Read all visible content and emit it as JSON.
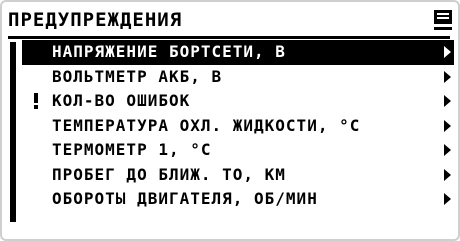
{
  "screen": {
    "title": "ПРЕДУПРЕЖДЕНИЯ",
    "menu_icon": "list-menu-icon"
  },
  "items": [
    {
      "label": "НАПРЯЖЕНИЕ БОРТСЕТИ, В",
      "selected": true,
      "warning": false
    },
    {
      "label": "ВОЛЬТМЕТР АКБ, В",
      "selected": false,
      "warning": false
    },
    {
      "label": "КОЛ-ВО ОШИБОК",
      "selected": false,
      "warning": true
    },
    {
      "label": "ТЕМПЕРАТУРА ОХЛ. ЖИДКОСТИ, °С",
      "selected": false,
      "warning": false
    },
    {
      "label": "ТЕРМОМЕТР 1, °С",
      "selected": false,
      "warning": false
    },
    {
      "label": "ПРОБЕГ ДО БЛИЖ. ТО, КМ",
      "selected": false,
      "warning": false
    },
    {
      "label": "ОБОРОТЫ ДВИГАТЕЛЯ, ОБ/МИН",
      "selected": false,
      "warning": false
    }
  ],
  "icons": {
    "submenu": "chevron-right-icon",
    "warning": "exclamation-icon"
  },
  "colors": {
    "foreground": "#000000",
    "background": "#ffffff",
    "selection": "#000000"
  }
}
